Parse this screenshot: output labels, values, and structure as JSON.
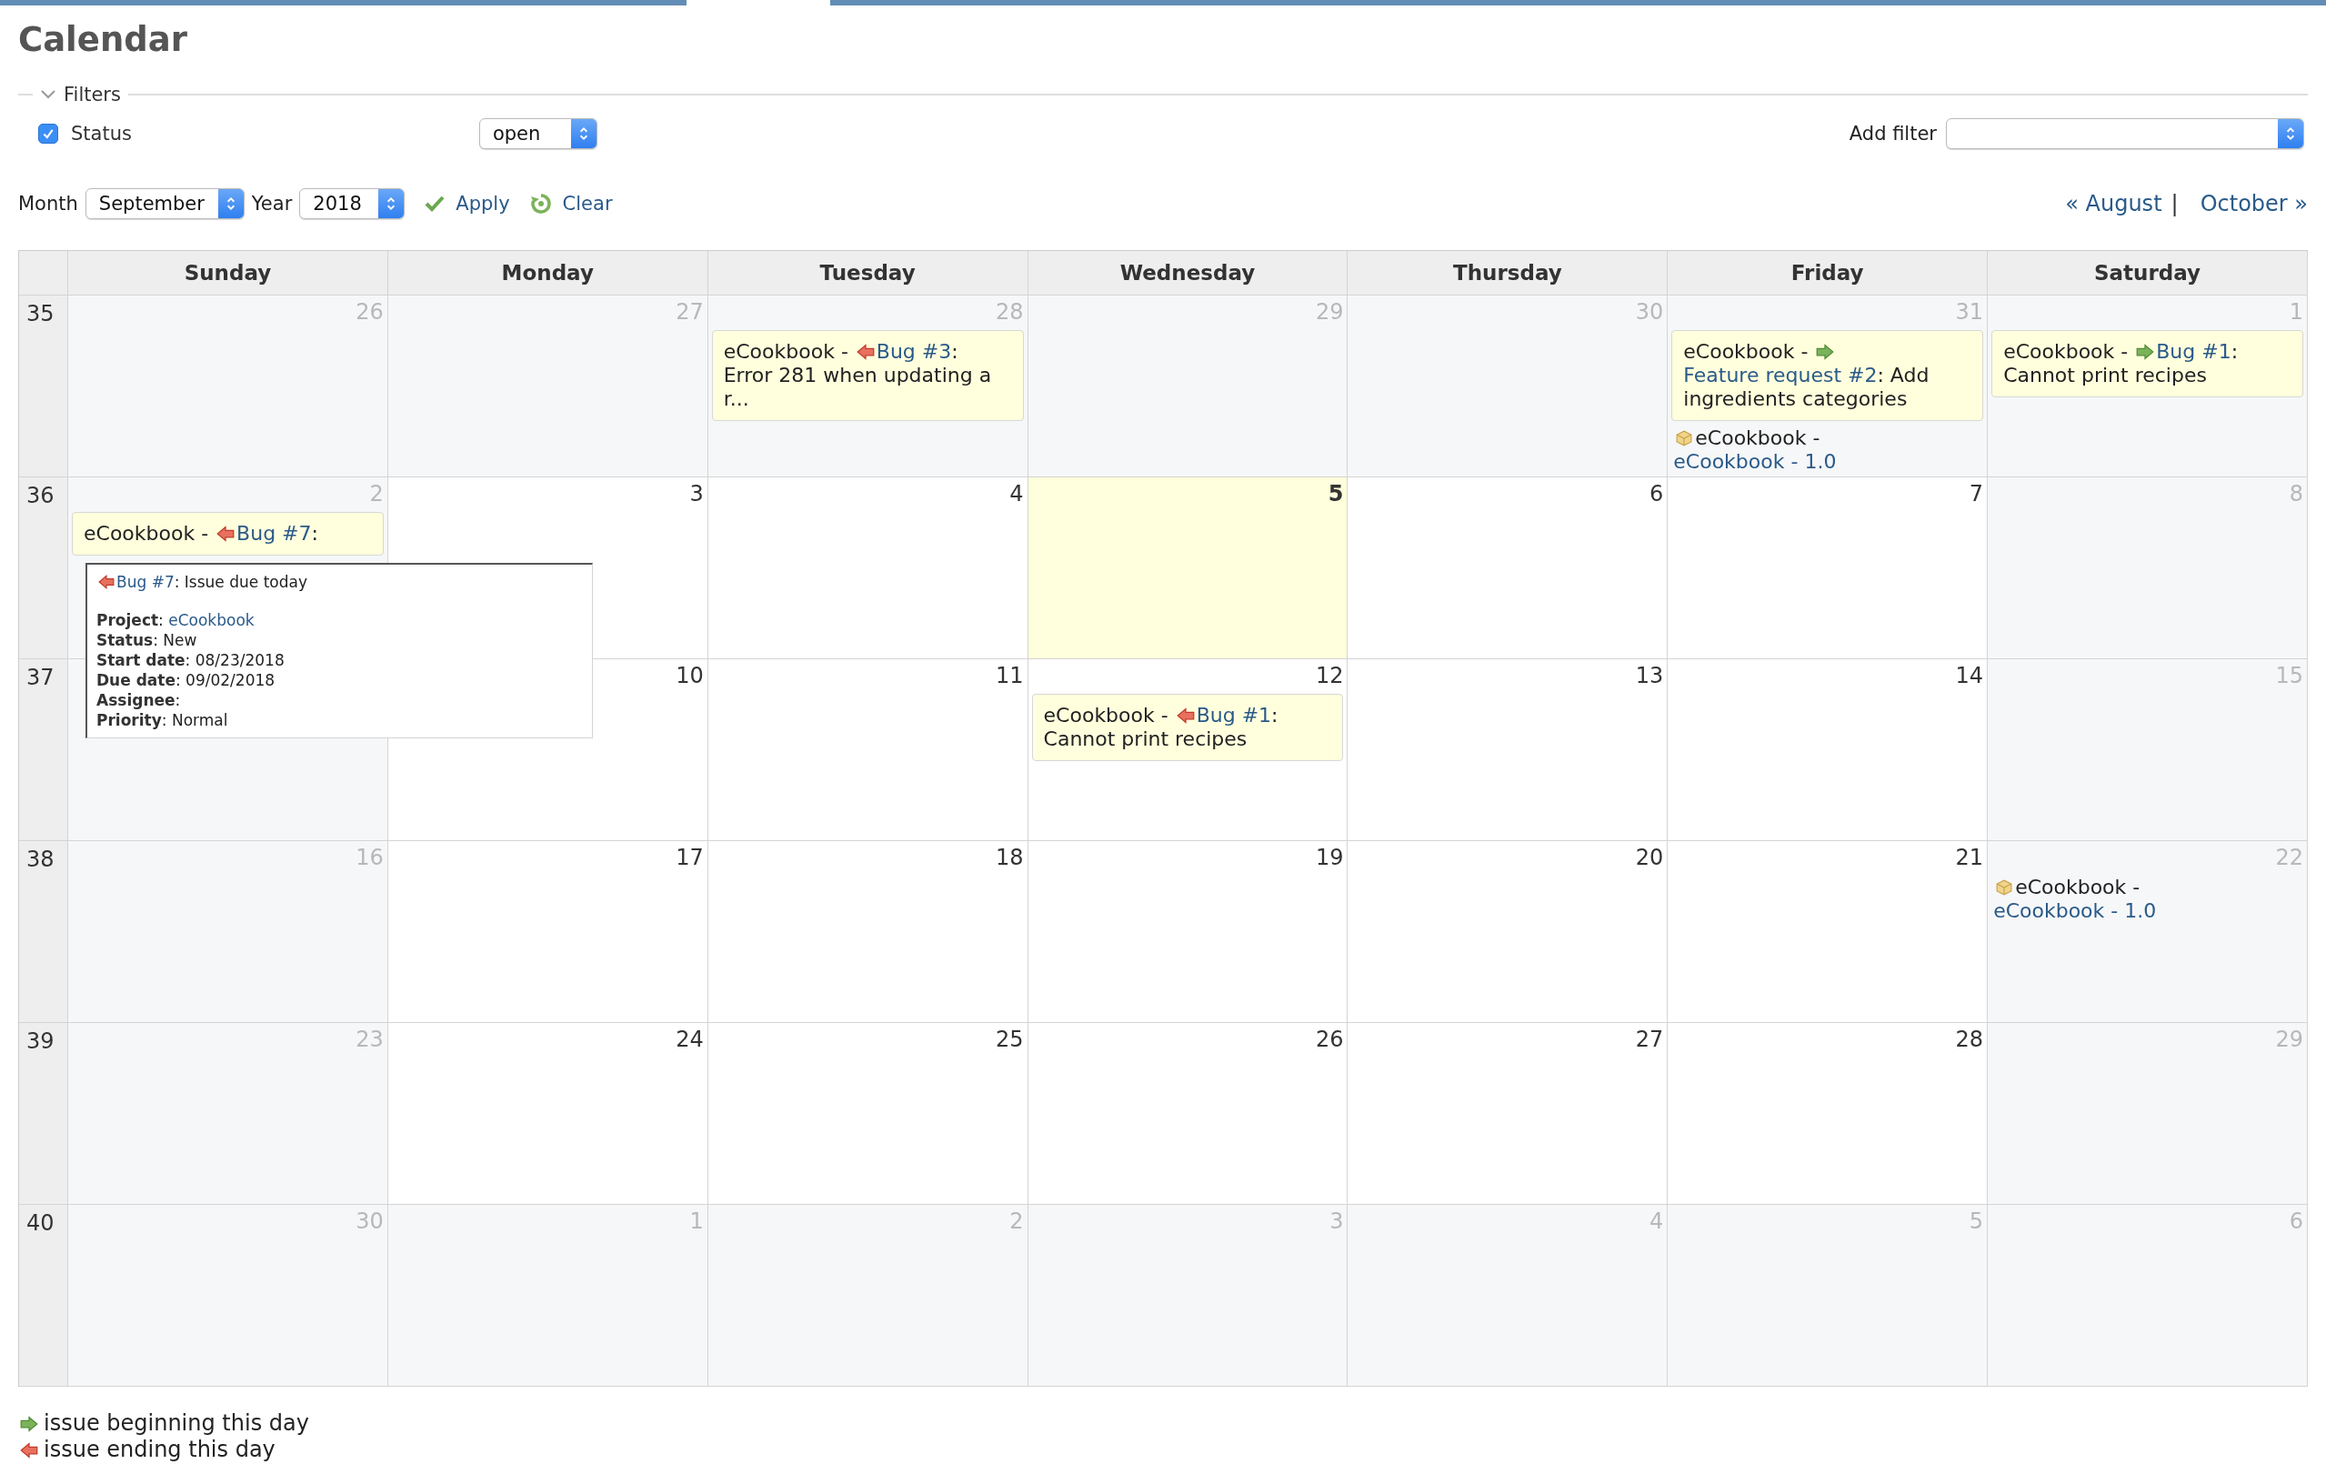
{
  "title": "Calendar",
  "filters": {
    "legend": "Filters",
    "expanded": true,
    "status": {
      "label": "Status",
      "checked": true,
      "value": "open"
    },
    "add_filter": {
      "label": "Add filter"
    }
  },
  "period": {
    "month_label": "Month",
    "month": "September",
    "year_label": "Year",
    "year": "2018",
    "apply": "Apply",
    "clear": "Clear",
    "prev": "« August",
    "separator": "|",
    "next": "October »"
  },
  "weekdays": [
    "Sunday",
    "Monday",
    "Tuesday",
    "Wednesday",
    "Thursday",
    "Friday",
    "Saturday"
  ],
  "weeks": [
    {
      "number": "35",
      "days": [
        {
          "day": "26",
          "kind": "other_month"
        },
        {
          "day": "27",
          "kind": "other_month"
        },
        {
          "day": "28",
          "kind": "other_month",
          "events": [
            {
              "kind": "issue_end",
              "project": "eCookbook - ",
              "link": "Bug #3",
              "subject": ": Error 281 when updating a r..."
            }
          ]
        },
        {
          "day": "29",
          "kind": "other_month"
        },
        {
          "day": "30",
          "kind": "other_month"
        },
        {
          "day": "31",
          "kind": "other_month",
          "events": [
            {
              "kind": "issue_start",
              "project": "eCookbook - ",
              "link": "Feature request #2",
              "subject": ": Add ingredients categories"
            },
            {
              "kind": "version",
              "project": "eCookbook - ",
              "link": "eCookbook - 1.0"
            }
          ]
        },
        {
          "day": "1",
          "kind": "weekend",
          "events": [
            {
              "kind": "issue_start",
              "project": "eCookbook - ",
              "link": "Bug #1",
              "subject": ": Cannot print recipes"
            }
          ]
        }
      ]
    },
    {
      "number": "36",
      "days": [
        {
          "day": "2",
          "kind": "weekend",
          "events": [
            {
              "kind": "issue_end",
              "project": "eCookbook - ",
              "link": "Bug #7",
              "subject": ":"
            }
          ]
        },
        {
          "day": "3",
          "kind": "day"
        },
        {
          "day": "4",
          "kind": "day"
        },
        {
          "day": "5",
          "kind": "today"
        },
        {
          "day": "6",
          "kind": "day"
        },
        {
          "day": "7",
          "kind": "day"
        },
        {
          "day": "8",
          "kind": "weekend"
        }
      ]
    },
    {
      "number": "37",
      "days": [
        {
          "kind": "weekend"
        },
        {
          "day": "10",
          "kind": "day"
        },
        {
          "day": "11",
          "kind": "day"
        },
        {
          "day": "12",
          "kind": "day",
          "events": [
            {
              "kind": "issue_end",
              "project": "eCookbook - ",
              "link": "Bug #1",
              "subject": ": Cannot print recipes"
            }
          ]
        },
        {
          "day": "13",
          "kind": "day"
        },
        {
          "day": "14",
          "kind": "day"
        },
        {
          "day": "15",
          "kind": "weekend"
        }
      ]
    },
    {
      "number": "38",
      "days": [
        {
          "day": "16",
          "kind": "weekend"
        },
        {
          "day": "17",
          "kind": "day"
        },
        {
          "day": "18",
          "kind": "day"
        },
        {
          "day": "19",
          "kind": "day"
        },
        {
          "day": "20",
          "kind": "day"
        },
        {
          "day": "21",
          "kind": "day"
        },
        {
          "day": "22",
          "kind": "weekend",
          "events": [
            {
              "kind": "version",
              "project": "eCookbook - ",
              "link": "eCookbook - 1.0"
            }
          ]
        }
      ]
    },
    {
      "number": "39",
      "days": [
        {
          "day": "23",
          "kind": "weekend"
        },
        {
          "day": "24",
          "kind": "day"
        },
        {
          "day": "25",
          "kind": "day"
        },
        {
          "day": "26",
          "kind": "day"
        },
        {
          "day": "27",
          "kind": "day"
        },
        {
          "day": "28",
          "kind": "day"
        },
        {
          "day": "29",
          "kind": "weekend"
        }
      ]
    },
    {
      "number": "40",
      "days": [
        {
          "day": "30",
          "kind": "weekend"
        },
        {
          "day": "1",
          "kind": "other_month"
        },
        {
          "day": "2",
          "kind": "other_month"
        },
        {
          "day": "3",
          "kind": "other_month"
        },
        {
          "day": "4",
          "kind": "other_month"
        },
        {
          "day": "5",
          "kind": "other_month"
        },
        {
          "day": "6",
          "kind": "other_month"
        }
      ]
    }
  ],
  "tooltip": {
    "kind": "issue_end",
    "link": "Bug #7",
    "subject": ": Issue due today",
    "fields": [
      {
        "kind": "link",
        "label": "**Project**:",
        "value": "eCookbook"
      },
      {
        "kind": "text",
        "label": "**Status**: New"
      },
      {
        "kind": "text",
        "label": "**Start date**: 08/23/2018"
      },
      {
        "kind": "text",
        "label": "**Due date**: 09/02/2018"
      },
      {
        "kind": "text",
        "label": "**Assignee**:"
      },
      {
        "kind": "text",
        "label": "**Priority**: Normal"
      }
    ]
  },
  "legend": [
    {
      "kind": "issue_start",
      "text": "issue beginning this day"
    },
    {
      "kind": "issue_end",
      "text": "issue ending this day"
    }
  ]
}
